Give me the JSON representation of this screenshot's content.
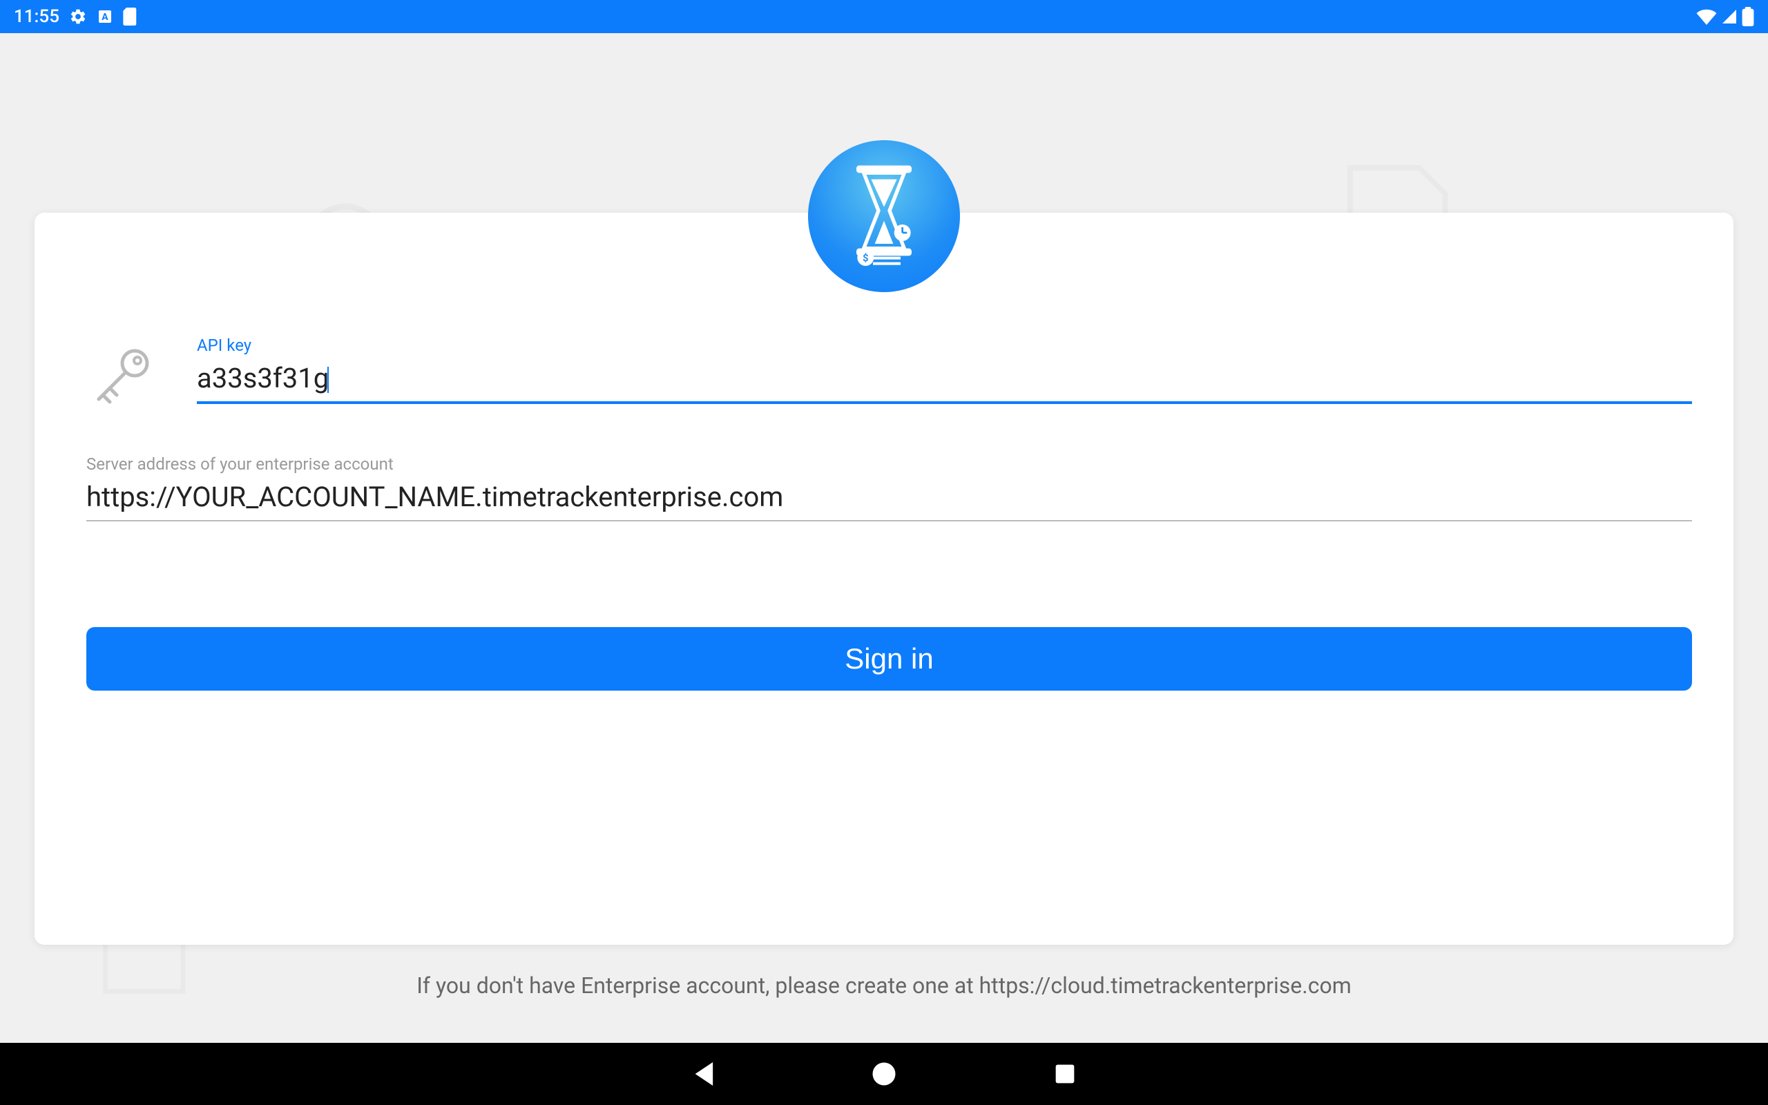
{
  "statusbar": {
    "time": "11:55"
  },
  "form": {
    "api_key_label": "API key",
    "api_key_value": "a33s3f31g",
    "server_label": "Server address of your enterprise account",
    "server_value": "https://YOUR_ACCOUNT_NAME.timetrackenterprise.com",
    "signin_label": "Sign in"
  },
  "footer": {
    "text": "If you don't have Enterprise account, please create one at https://cloud.timetrackenterprise.com"
  }
}
